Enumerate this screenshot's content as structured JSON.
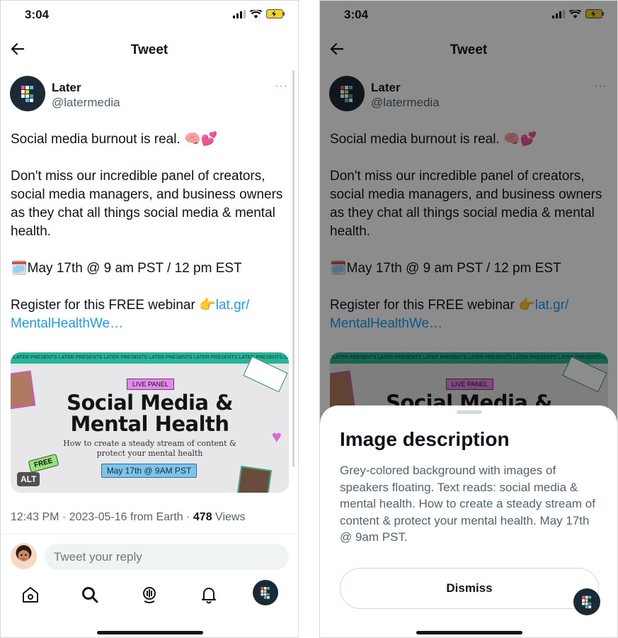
{
  "status": {
    "time": "3:04"
  },
  "nav": {
    "title": "Tweet"
  },
  "author": {
    "name": "Later",
    "handle": "@latermedia",
    "more": "···"
  },
  "tweet": {
    "line1": "Social media burnout is real. 🧠💕",
    "line2": "Don't miss our incredible panel of creators, social media managers, and business owners as they chat all things social media & mental health.",
    "line3": "🗓️May 17th @ 9 am PST / 12 pm EST",
    "line4_prefix": "Register for this FREE webinar 👉",
    "link": "lat.gr/ MentalHealthWe…"
  },
  "media": {
    "ticker": "LATER PRESENTS   LATER PRESENTS   LATER PRESENTS   LATER PRESENTS   LATER PRESENTS   LATER PRESENTS   LATER PRESENTS   LATER PRESENTS",
    "badge": "LIVE PANEL",
    "headline1": "Social Media &",
    "headline2": "Mental Health",
    "subtitle1": "How to create a steady stream of content &",
    "subtitle2": "protect your mental health",
    "date": "May 17th @ 9AM PST",
    "free": "FREE",
    "alt": "ALT"
  },
  "meta": {
    "timestamp": "12:43 PM · 2023-05-16 from Earth · ",
    "views_count": "478",
    "views_label": " Views"
  },
  "reply": {
    "placeholder": "Tweet your reply"
  },
  "sheet": {
    "title": "Image description",
    "description": "Grey-colored background with images of speakers floating. Text reads: social media & mental health. How to create a steady stream of content & protect your mental health. May 17th @ 9am PST.",
    "dismiss": "Dismiss"
  },
  "colors": {
    "link": "#1d9bf0",
    "secondary_text": "#536471",
    "ticker_green": "#29b59a"
  }
}
